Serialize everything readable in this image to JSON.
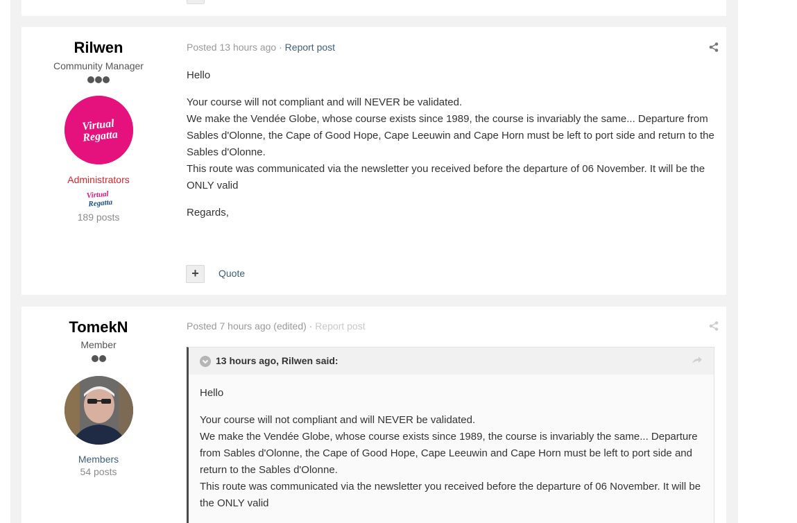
{
  "posts": [
    {
      "author_name": "Rilwen",
      "author_title": "Community Manager",
      "rank_dots": 3,
      "group_name": "Administrators",
      "group_icon_lines": [
        "Virtual",
        "Regatta"
      ],
      "avatar_logo_lines": [
        "Virtual",
        "Regatta"
      ],
      "post_count": "189 posts",
      "meta_posted": "Posted 13 hours ago",
      "meta_edited": "",
      "meta_separator": " · ",
      "report_label": "Report post",
      "content": {
        "greeting": "Hello",
        "lines": [
          "Your course will not compliant and will NEVER be validated.",
          "We make the Vendée Globe, whose course exists since 1989, the course is invariably the same... Departure from Sables d'Olonne, the Cape of Good Hope, Cape Leeuwin and Cape Horn must be left to port side and return to the Sables d'Olonne.",
          "This route was communicated via the newsletter you received before the departure of 06 November. It will be the ONLY valid"
        ],
        "closing": "Regards,"
      },
      "plus_label": "+",
      "quote_label": "Quote"
    },
    {
      "author_name": "TomekN",
      "author_title": "Member",
      "rank_dots": 2,
      "group_name": "Members",
      "post_count": "54 posts",
      "meta_posted": "Posted 7 hours ago",
      "meta_edited": " (edited)",
      "meta_separator": " · ",
      "report_label": "Report post",
      "quote": {
        "cite": "13 hours ago, Rilwen said:",
        "greeting": "Hello",
        "lines": [
          "Your course will not compliant and will NEVER be validated.",
          "We make the Vendée Globe, whose course exists since 1989, the course is invariably the same... Departure from Sables d'Olonne, the Cape of Good Hope, Cape Leeuwin and Cape Horn must be left to port side and return to the Sables d'Olonne.",
          "This route was communicated via the newsletter you received before the departure of 06 November. It will be the ONLY valid"
        ]
      }
    }
  ],
  "colors": {
    "link": "#3d5e78",
    "admin_group": "#d9252c",
    "brand_pink": "#e5127d",
    "muted": "#999999"
  },
  "icons": {
    "share": "share-icon",
    "quote_toggle": "chevron-down-icon",
    "quote_share": "share-arrow-icon"
  }
}
